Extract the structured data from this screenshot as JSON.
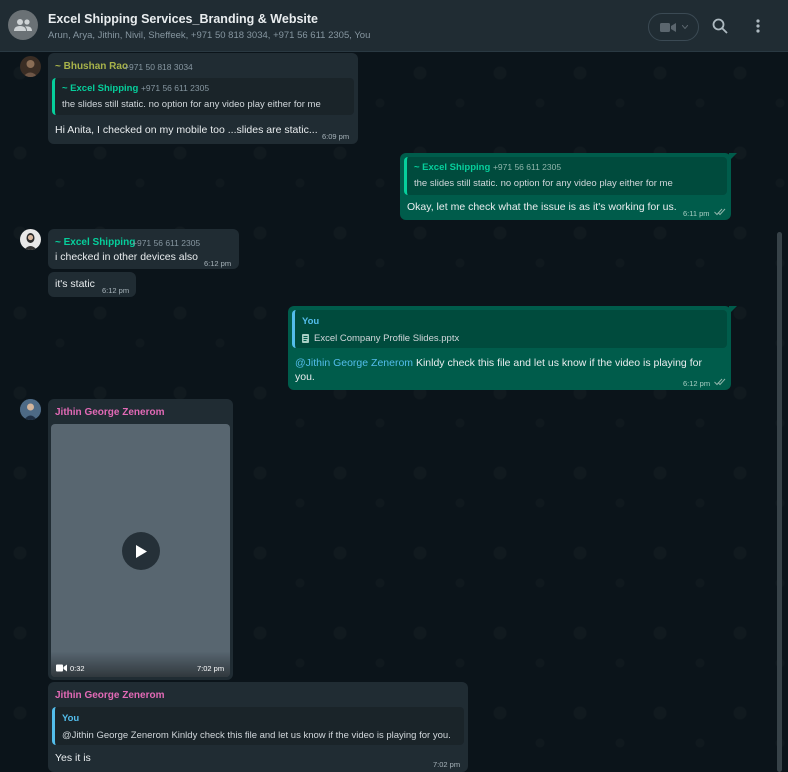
{
  "header": {
    "title": "Excel Shipping Services_Branding & Website",
    "members": "Arun, Arya, Jithin, Nivil, Sheffeek, +971 50 818 3034, +971 56 611 2305, You"
  },
  "colors": {
    "header_bg": "#202c33",
    "chat_bg": "#0b141a",
    "incoming_bubble": "#202c33",
    "outgoing_bubble": "#005c4b",
    "sender_bhushan": "#a8b34a",
    "sender_jithin": "#e26ab6",
    "quote_green": "#06cf9c",
    "quote_blue": "#53bdeb"
  },
  "icons": {
    "group": "group-icon",
    "video_call": "video-camera-icon",
    "search": "search-icon",
    "menu": "more-vertical-icon",
    "play": "play-icon",
    "read": "double-check-icon",
    "document": "document-icon"
  },
  "messages": [
    {
      "sender": "~ Bhushan Rao",
      "phone": "+971 50 818 3034",
      "quote_sender": "~ Excel Shipping",
      "quote_phone": "+971 56 611 2305",
      "quote_text": "the slides still static. no option for any video play either for me",
      "text": "Hi Anita, I checked on my mobile too ...slides are static...",
      "time": "6:09 pm"
    },
    {
      "quote_sender": "~ Excel Shipping",
      "quote_phone": "+971 56 611 2305",
      "quote_text": "the slides still static. no option for any video play either for me",
      "text": "Okay, let me check what the issue is as it's working for us.",
      "time": "6:11 pm"
    },
    {
      "sender": "~ Excel Shipping",
      "phone": "+971 56 611 2305",
      "text": "i checked in other devices also",
      "time": "6:12 pm"
    },
    {
      "text": "it's static",
      "time": "6:12 pm"
    },
    {
      "quote_sender": "You",
      "quote_text": "Excel Company Profile Slides.pptx",
      "mention": "@Jithin George Zenerom",
      "text_line1": " Kinldy check this file and let us know if the video is playing for",
      "text_line2": "you.",
      "time": "6:12 pm"
    },
    {
      "sender": "Jithin George Zenerom",
      "video_duration": "0:32",
      "time": "7:02 pm"
    },
    {
      "sender": "Jithin George Zenerom",
      "quote_sender": "You",
      "quote_text": "@Jithin George Zenerom Kinldy check this file and let us know if the video is playing for you.",
      "text": "Yes it is",
      "time": "7:02 pm"
    }
  ]
}
